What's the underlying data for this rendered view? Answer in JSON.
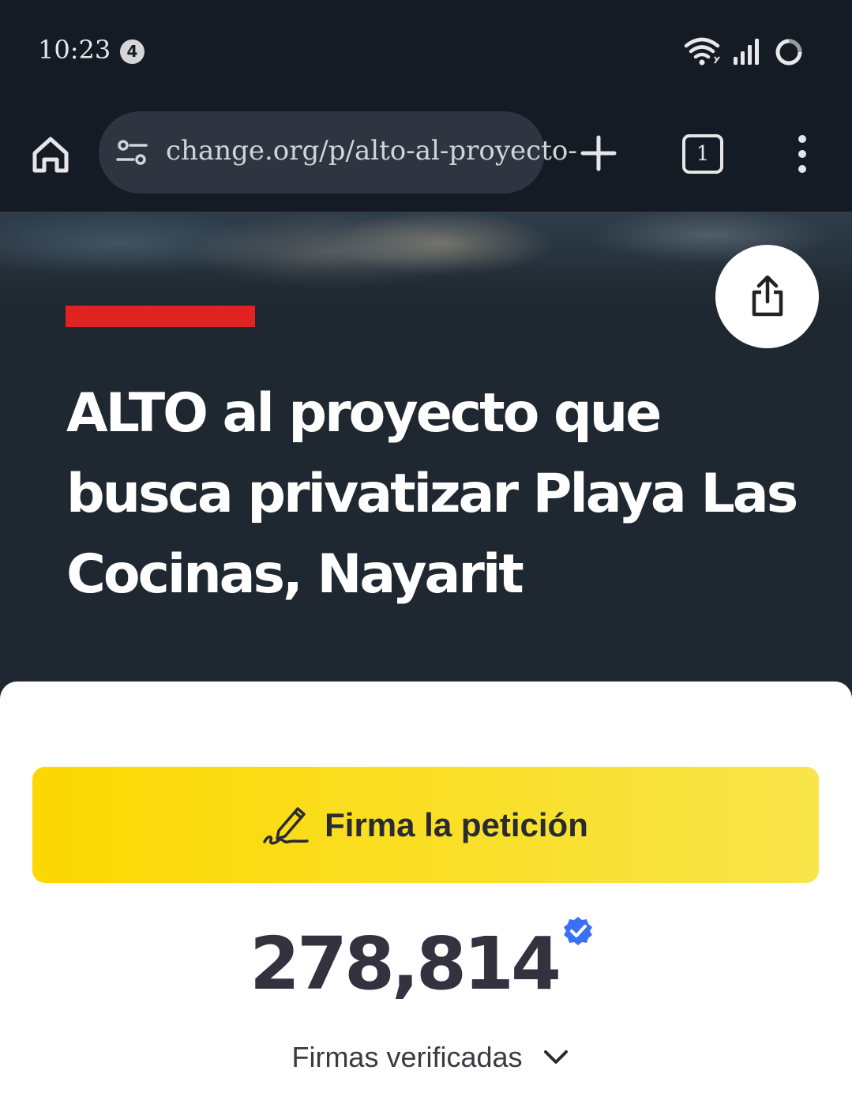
{
  "status_bar": {
    "time": "10:23",
    "notification_count": "4",
    "icons": [
      "wifi-icon",
      "signal-icon",
      "sync-icon"
    ]
  },
  "browser": {
    "url": "change.org/p/alto-al-proyecto-",
    "tab_count": "1",
    "icons": [
      "home-icon",
      "tune-icon",
      "plus-icon",
      "tabs-icon",
      "more-vert-icon"
    ]
  },
  "hero": {
    "title": "ALTO al proyecto que busca privatizar Playa Las Cocinas, Nayarit",
    "accent_color": "#e02320",
    "share_icon": "share-icon"
  },
  "petition": {
    "sign_button_label": "Firma la petición",
    "sign_icon": "pen-signature-icon",
    "button_color": "#fbd800",
    "signature_count": "278,814",
    "verified_icon": "verified-badge-icon",
    "verified_color": "#3b6ff5",
    "verified_label": "Firmas verificadas",
    "expand_icon": "chevron-down-icon"
  }
}
